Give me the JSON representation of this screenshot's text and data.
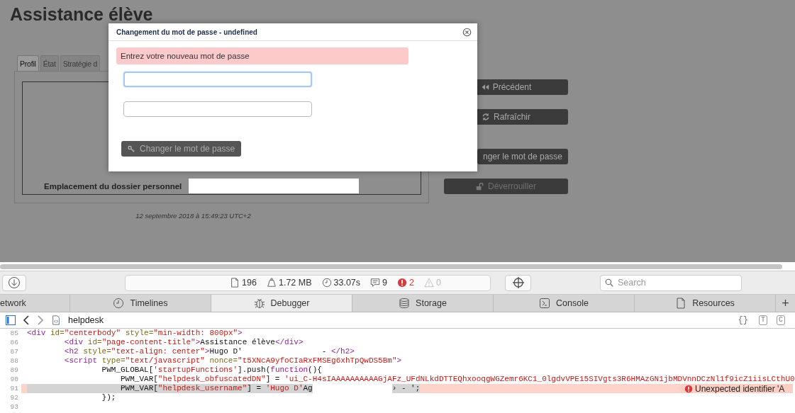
{
  "page": {
    "title": "Assistance élève",
    "tabs": [
      {
        "label": "Profil",
        "selected": true
      },
      {
        "label": "État",
        "selected": false
      },
      {
        "label": "Stratégie d",
        "selected": false
      }
    ],
    "field_label": "Emplacement du dossier personnel",
    "timestamp": "12 septembre 2018 à 15:49:23 UTC+2",
    "actions": [
      {
        "kind": "previous",
        "label": "Précédent",
        "disabled": false
      },
      {
        "kind": "refresh",
        "label": "Rafraîchir",
        "disabled": false
      },
      {
        "kind": "password",
        "label": "nger le mot de passe",
        "disabled": false
      },
      {
        "kind": "unlock",
        "label": "Déverrouiller",
        "disabled": true
      }
    ]
  },
  "dialog": {
    "title": "Changement du mot de passe - undefined",
    "message": "Entrez votre nouveau mot de passe",
    "fields": [
      {
        "focused": true
      },
      {
        "focused": false
      }
    ],
    "button": {
      "label": "Changer le mot de passe",
      "disabled": true
    }
  },
  "devtools": {
    "status": [
      {
        "kind": "resources",
        "text": "196"
      },
      {
        "kind": "size",
        "text": "1.72 MB"
      },
      {
        "kind": "time",
        "text": "33.07s"
      },
      {
        "kind": "messages",
        "text": "9"
      },
      {
        "kind": "errors",
        "text": "2"
      },
      {
        "kind": "warnings",
        "text": "0"
      }
    ],
    "search": {
      "placeholder": "Search"
    },
    "tabs": [
      {
        "kind": "network",
        "label": "etwork",
        "selected": false
      },
      {
        "kind": "timelines",
        "label": "Timelines",
        "selected": false
      },
      {
        "kind": "debugger",
        "label": "Debugger",
        "selected": true
      },
      {
        "kind": "storage",
        "label": "Storage",
        "selected": false
      },
      {
        "kind": "console",
        "label": "Console",
        "selected": false
      },
      {
        "kind": "resources",
        "label": "Resources",
        "selected": false
      }
    ],
    "add_tab": "+",
    "file": "helpdesk",
    "format_buttons": [
      "{}",
      "T",
      "C"
    ],
    "lines": [
      {
        "number": "85",
        "error": false,
        "parts": [
          {
            "kind": "code",
            "highlighted": false,
            "tokens": [
              {
                "kind": "tag",
                "text": "<div "
              },
              {
                "kind": "attr",
                "text": "id="
              },
              {
                "kind": "str",
                "text": "\"centerbody\" "
              },
              {
                "kind": "attr",
                "text": "style="
              },
              {
                "kind": "str",
                "text": "\"min-width: 800px\""
              },
              {
                "kind": "tag",
                "text": ">"
              }
            ]
          }
        ]
      },
      {
        "number": "86",
        "error": false,
        "parts": [
          {
            "kind": "code",
            "highlighted": false,
            "tokens": [
              {
                "kind": "tag",
                "text": "        <div "
              },
              {
                "kind": "attr",
                "text": "id="
              },
              {
                "kind": "str",
                "text": "\"page-content-title\""
              },
              {
                "kind": "tag",
                "text": ">"
              },
              {
                "kind": "plain",
                "text": "Assistance élève"
              },
              {
                "kind": "tag",
                "text": "</div>"
              }
            ]
          }
        ]
      },
      {
        "number": "87",
        "error": false,
        "parts": [
          {
            "kind": "code",
            "highlighted": false,
            "tokens": [
              {
                "kind": "tag",
                "text": "        <h2 "
              },
              {
                "kind": "attr",
                "text": "style="
              },
              {
                "kind": "str",
                "text": "\"text-align: center\""
              },
              {
                "kind": "tag",
                "text": ">"
              },
              {
                "kind": "plain",
                "text": "Hugo D'"
              }
            ]
          },
          {
            "kind": "redacted"
          },
          {
            "kind": "code",
            "highlighted": false,
            "tokens": [
              {
                "kind": "plain",
                "text": "- "
              },
              {
                "kind": "tag",
                "text": "</h2>"
              }
            ]
          }
        ]
      },
      {
        "number": "88",
        "error": false,
        "parts": [
          {
            "kind": "code",
            "highlighted": false,
            "tokens": [
              {
                "kind": "tag",
                "text": "        <script "
              },
              {
                "kind": "attr",
                "text": "type="
              },
              {
                "kind": "str",
                "text": "\"text/javascript\" "
              },
              {
                "kind": "attr",
                "text": "nonce="
              },
              {
                "kind": "str",
                "text": "\"t5XNcA9yfoCIaRxFMSEg6xhTpQwDS5Bm\""
              },
              {
                "kind": "tag",
                "text": ">"
              }
            ]
          }
        ]
      },
      {
        "number": "89",
        "error": false,
        "parts": [
          {
            "kind": "code",
            "highlighted": false,
            "tokens": [
              {
                "kind": "plain",
                "text": "                PWM_GLOBAL["
              },
              {
                "kind": "str",
                "text": "'startupFunctions'"
              },
              {
                "kind": "plain",
                "text": "].push("
              },
              {
                "kind": "kw",
                "text": "function"
              },
              {
                "kind": "plain",
                "text": "(){"
              }
            ]
          }
        ]
      },
      {
        "number": "90",
        "error": false,
        "parts": [
          {
            "kind": "code",
            "highlighted": false,
            "tokens": [
              {
                "kind": "plain",
                "text": "                    PWM_VAR["
              },
              {
                "kind": "str",
                "text": "\"helpdesk_obfuscatedDN\""
              },
              {
                "kind": "plain",
                "text": "] = "
              },
              {
                "kind": "str",
                "text": "'ui_C-H4sIAAAAAAAAAAGjAFz_UFdNLkdDTTEQhxooqgWGZemr6KC1_0lgdvVPE15SIVgts3R6HMAzGN1jbMDVnnDCzNl1f9icZ1iisLCthU0"
              }
            ]
          }
        ]
      },
      {
        "number": "91",
        "error": true,
        "error_message": "Unexpected identifier 'A",
        "parts": [
          {
            "kind": "code",
            "highlighted": true,
            "tokens": [
              {
                "kind": "plain",
                "text": "                    PWM_VAR["
              },
              {
                "kind": "str",
                "text": "\"helpdesk_username\""
              },
              {
                "kind": "plain",
                "text": "] = "
              },
              {
                "kind": "str",
                "text": "'Hugo D'"
              },
              {
                "kind": "plain",
                "text": "Ag"
              }
            ]
          },
          {
            "kind": "redacted"
          },
          {
            "kind": "code",
            "highlighted": true,
            "tokens": [
              {
                "kind": "plain",
                "text": "› - ';"
              }
            ]
          }
        ]
      },
      {
        "number": "92",
        "error": false,
        "parts": [
          {
            "kind": "code",
            "highlighted": false,
            "tokens": [
              {
                "kind": "plain",
                "text": "                });"
              }
            ]
          }
        ]
      },
      {
        "number": "93",
        "error": false
      }
    ]
  }
}
